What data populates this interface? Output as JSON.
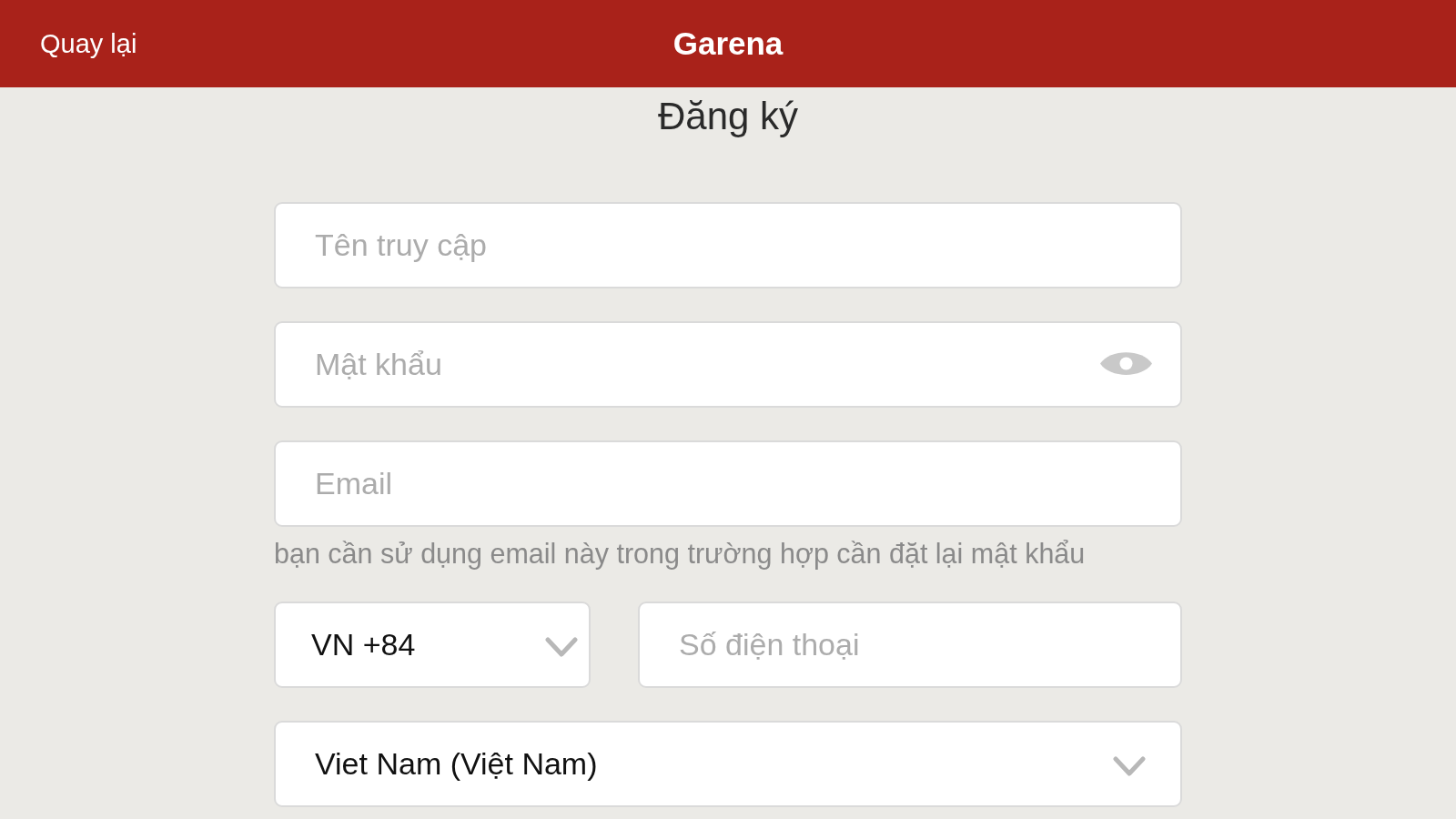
{
  "header": {
    "back_label": "Quay lại",
    "title": "Garena"
  },
  "page_title": "Đăng ký",
  "fields": [
    {
      "kind": "text",
      "placeholder": "Tên truy cập"
    },
    {
      "kind": "password",
      "placeholder": "Mật khẩu"
    },
    {
      "kind": "email",
      "placeholder": "Email",
      "hint": "bạn cần sử dụng email này trong trường hợp cần đặt lại mật khẩu"
    }
  ],
  "phone": {
    "country_code": "VN +84",
    "placeholder": "Số điện thoại"
  },
  "region": {
    "value": "Viet Nam (Việt Nam)"
  }
}
